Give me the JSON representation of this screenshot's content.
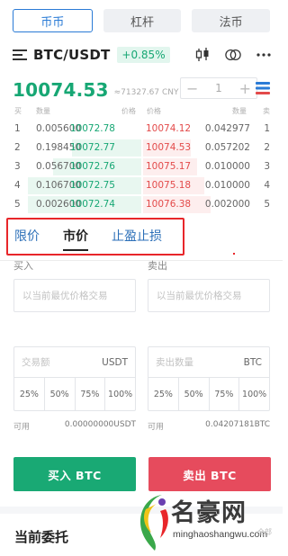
{
  "market_tabs": [
    {
      "label": "币币",
      "active": true
    },
    {
      "label": "杠杆",
      "active": false
    },
    {
      "label": "法币",
      "active": false
    }
  ],
  "pair": {
    "name": "BTC/USDT",
    "change": "+0.85%"
  },
  "ticker": {
    "last_price": "10074.53",
    "cny_price": "≈71327.67 CNY"
  },
  "depth_stepper": {
    "minus": "−",
    "value": "1",
    "plus": "+"
  },
  "orderbook": {
    "headers": {
      "buy_index": "买",
      "amount": "数量",
      "bid_price": "价格",
      "ask_price": "价格",
      "ask_amount": "数量",
      "sell_index": "卖"
    },
    "rows": [
      {
        "idx": "1",
        "bid_amount": "0.005600",
        "bid_price": "10072.78",
        "ask_price": "10074.12",
        "ask_amount": "0.042977",
        "idx2": "1",
        "bid_depth": 0.0,
        "ask_depth": 0.0
      },
      {
        "idx": "2",
        "bid_amount": "0.198450",
        "bid_price": "10072.77",
        "ask_price": "10074.53",
        "ask_amount": "0.057202",
        "idx2": "2",
        "bid_depth": 0.55,
        "ask_depth": 0.35
      },
      {
        "idx": "3",
        "bid_amount": "0.056700",
        "bid_price": "10072.76",
        "ask_price": "10075.17",
        "ask_amount": "0.010000",
        "idx2": "3",
        "bid_depth": 0.7,
        "ask_depth": 0.4
      },
      {
        "idx": "4",
        "bid_amount": "0.106700",
        "bid_price": "10072.75",
        "ask_price": "10075.18",
        "ask_amount": "0.010000",
        "idx2": "4",
        "bid_depth": 0.9,
        "ask_depth": 0.45
      },
      {
        "idx": "5",
        "bid_amount": "0.002600",
        "bid_price": "10072.74",
        "ask_price": "10076.38",
        "ask_amount": "0.002000",
        "idx2": "5",
        "bid_depth": 0.9,
        "ask_depth": 0.5
      }
    ]
  },
  "order_types": [
    {
      "label": "限价",
      "active": false
    },
    {
      "label": "市价",
      "active": true
    },
    {
      "label": "止盈止损",
      "active": false
    }
  ],
  "buy_form": {
    "label": "买入",
    "price_placeholder": "以当前最优价格交易",
    "amount_placeholder": "交易额",
    "unit": "USDT",
    "percents": [
      "25%",
      "50%",
      "75%",
      "100%"
    ],
    "available_label": "可用",
    "available_value": "0.00000000USDT",
    "button": "买入 BTC"
  },
  "sell_form": {
    "label": "卖出",
    "price_placeholder": "以当前最优价格交易",
    "amount_placeholder": "卖出数量",
    "unit": "BTC",
    "percents": [
      "25%",
      "50%",
      "75%",
      "100%"
    ],
    "available_label": "可用",
    "available_value": "0.04207181BTC",
    "button": "卖出 BTC"
  },
  "current_orders_title": "当前委托",
  "watermark": {
    "text": "名豪网",
    "url": "minghaoshangwu.com",
    "note": "全部"
  },
  "colors": {
    "accent_blue": "#2a7bd6",
    "green": "#17a774",
    "red": "#e34a4a",
    "highlight_red": "#e8262a"
  }
}
